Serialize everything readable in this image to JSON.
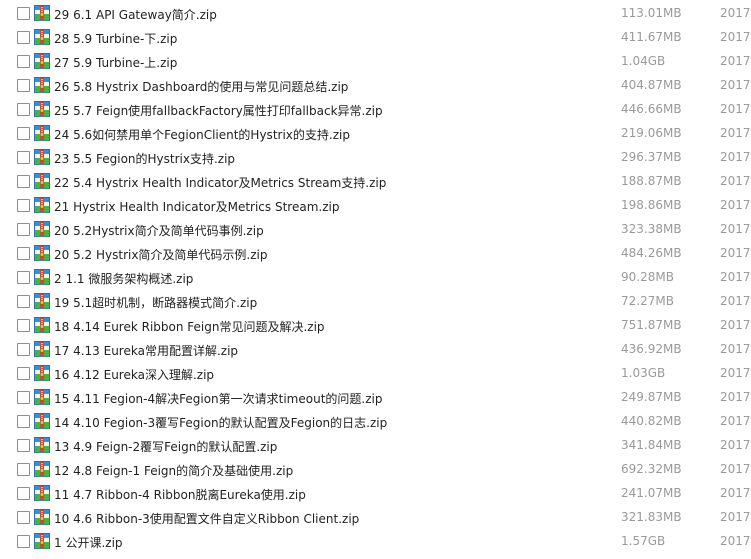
{
  "icons": {
    "file_icon": "zip-archive-icon"
  },
  "colors": {
    "name_text": "#222222",
    "meta_text": "#9a9a9a",
    "checkbox_border": "#8f8f8f"
  },
  "files": [
    {
      "name": "29 6.1 API Gateway简介.zip",
      "size": "113.01MB",
      "date": "2017-"
    },
    {
      "name": "28 5.9 Turbine-下.zip",
      "size": "411.67MB",
      "date": "2017-"
    },
    {
      "name": "27 5.9 Turbine-上.zip",
      "size": "1.04GB",
      "date": "2017-"
    },
    {
      "name": "26 5.8 Hystrix Dashboard的使用与常见问题总结.zip",
      "size": "404.87MB",
      "date": "2017-"
    },
    {
      "name": "25 5.7 Feign使用fallbackFactory属性打印fallback异常.zip",
      "size": "446.66MB",
      "date": "2017-"
    },
    {
      "name": "24 5.6如何禁用单个FegionClient的Hystrix的支持.zip",
      "size": "219.06MB",
      "date": "2017-"
    },
    {
      "name": "23 5.5 Fegion的Hystrix支持.zip",
      "size": "296.37MB",
      "date": "2017-"
    },
    {
      "name": "22 5.4 Hystrix Health Indicator及Metrics Stream支持.zip",
      "size": "188.87MB",
      "date": "2017-"
    },
    {
      "name": "21 Hystrix Health Indicator及Metrics Stream.zip",
      "size": "198.86MB",
      "date": "2017-"
    },
    {
      "name": "20 5.2Hystrix简介及简单代码事例.zip",
      "size": "323.38MB",
      "date": "2017-"
    },
    {
      "name": "20 5.2 Hystrix简介及简单代码示例.zip",
      "size": "484.26MB",
      "date": "2017-"
    },
    {
      "name": "2 1.1 微服务架构概述.zip",
      "size": "90.28MB",
      "date": "2017-"
    },
    {
      "name": "19 5.1超时机制，断路器模式简介.zip",
      "size": "72.27MB",
      "date": "2017-"
    },
    {
      "name": "18 4.14 Eurek Ribbon Feign常见问题及解决.zip",
      "size": "751.87MB",
      "date": "2017-"
    },
    {
      "name": "17 4.13 Eureka常用配置详解.zip",
      "size": "436.92MB",
      "date": "2017-"
    },
    {
      "name": "16 4.12 Eureka深入理解.zip",
      "size": "1.03GB",
      "date": "2017-"
    },
    {
      "name": "15 4.11 Fegion-4解决Fegion第一次请求timeout的问题.zip",
      "size": "249.87MB",
      "date": "2017-"
    },
    {
      "name": "14 4.10 Fegion-3覆写Fegion的默认配置及Fegion的日志.zip",
      "size": "440.82MB",
      "date": "2017-"
    },
    {
      "name": "13 4.9 Feign-2覆写Feign的默认配置.zip",
      "size": "341.84MB",
      "date": "2017-"
    },
    {
      "name": "12 4.8 Feign-1 Feign的简介及基础使用.zip",
      "size": "692.32MB",
      "date": "2017-"
    },
    {
      "name": "11 4.7 Ribbon-4 Ribbon脱离Eureka使用.zip",
      "size": "241.07MB",
      "date": "2017-"
    },
    {
      "name": "10 4.6 Ribbon-3使用配置文件自定义Ribbon Client.zip",
      "size": "321.83MB",
      "date": "2017-"
    },
    {
      "name": "1 公开课.zip",
      "size": "1.57GB",
      "date": "2017-"
    }
  ]
}
